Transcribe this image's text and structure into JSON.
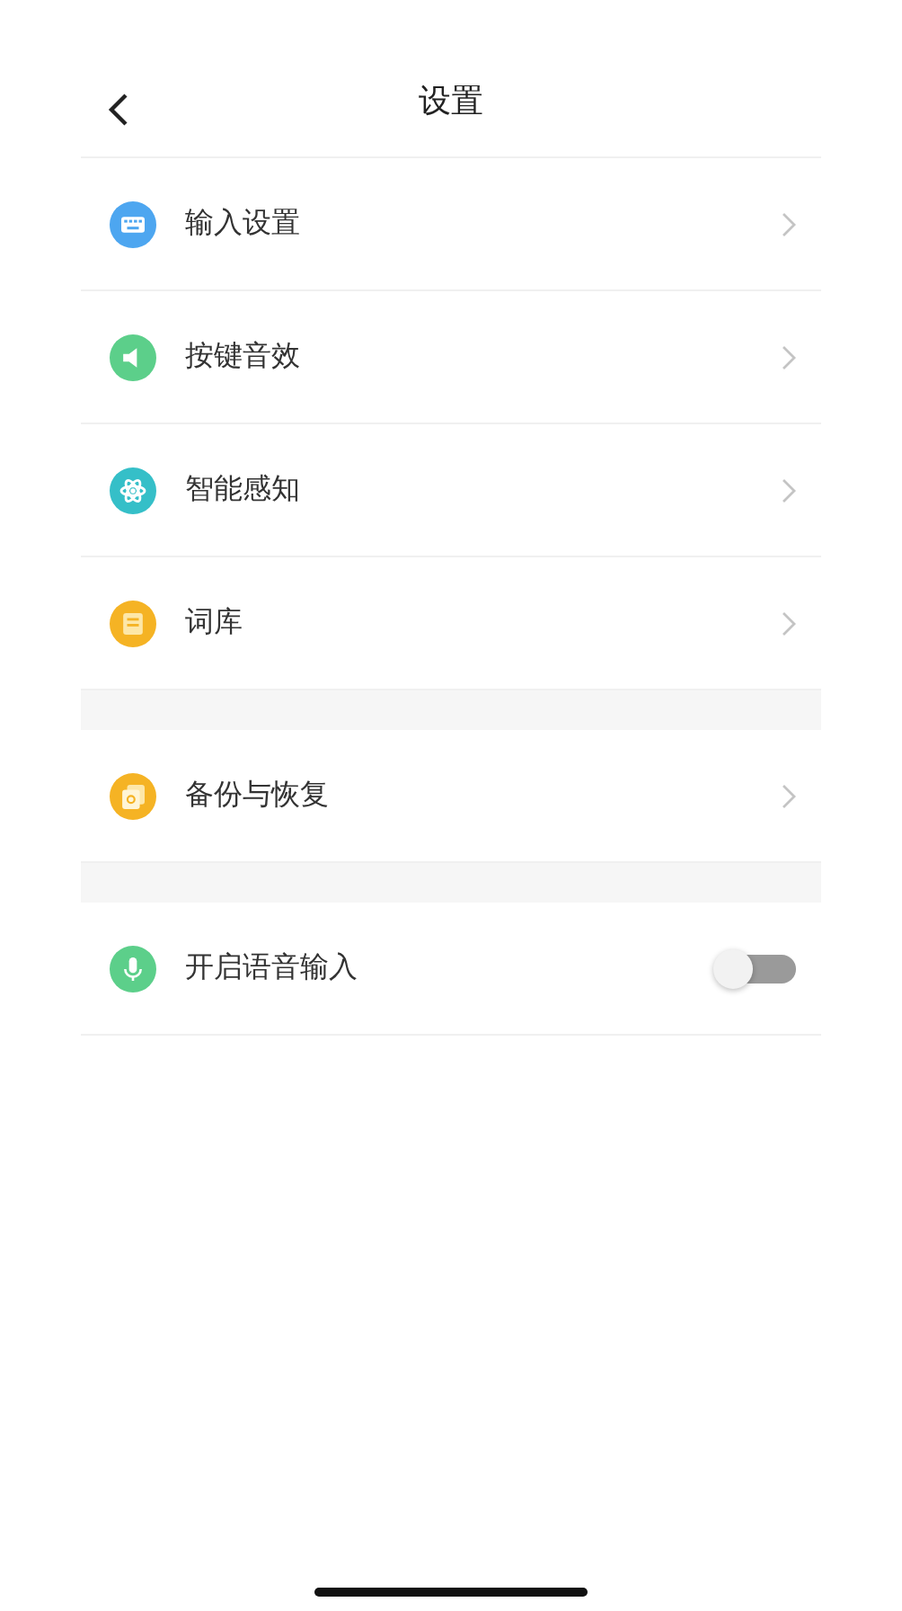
{
  "header": {
    "title": "设置"
  },
  "groups": [
    {
      "items": [
        {
          "kind": "link",
          "label": "输入设置"
        },
        {
          "kind": "link",
          "label": "按键音效"
        },
        {
          "kind": "link",
          "label": "智能感知"
        },
        {
          "kind": "link",
          "label": "词库"
        }
      ]
    },
    {
      "items": [
        {
          "kind": "link",
          "label": "备份与恢复"
        }
      ]
    },
    {
      "items": [
        {
          "kind": "toggle",
          "label": "开启语音输入",
          "on": false
        }
      ]
    }
  ]
}
